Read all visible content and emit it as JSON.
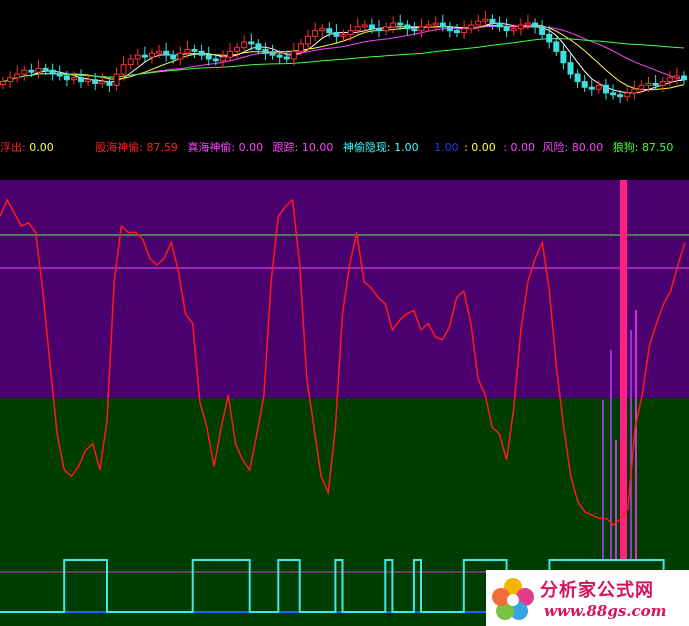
{
  "legend": {
    "fuchu": {
      "label": "浮出:",
      "value": "0.00",
      "color": "#ff2020"
    },
    "guhai": {
      "label": "股海神偷:",
      "value": "87.59",
      "color": "#ff2020"
    },
    "zhenhai": {
      "label": "真海神偷:",
      "value": "0.00",
      "color": "#ff40ff"
    },
    "genzong": {
      "label": "跟踪:",
      "value": "10.00",
      "color": "#ff40ff"
    },
    "yinxian": {
      "label": "神偷隐现:",
      "value": "1.00",
      "color": "#40ffff"
    },
    "blank1": {
      "value": "1.00",
      "color": "#3030ff"
    },
    "blank2": {
      "value": ": 0.00",
      "color": "#ffff40"
    },
    "blank3": {
      "value": ": 0.00",
      "color": "#ff40ff"
    },
    "fengxian": {
      "label": "风险:",
      "value": "80.00",
      "color": "#ff40ff"
    },
    "langou": {
      "label": "狼狗:",
      "value": "87.50",
      "color": "#40ff40"
    }
  },
  "watermark": {
    "title": "分析家公式网",
    "url": "www.88gs.com"
  },
  "colors": {
    "background": "#000000",
    "upper_zone": "#4b0070",
    "lower_zone": "#003d00",
    "main_line": "#ff1a1a",
    "signal_line": "#40e8e8",
    "ref_line_green": "#40ff40",
    "ref_line_magenta": "#ff40ff",
    "spike": "#ff2080",
    "watermark_text": "#d8125b"
  },
  "indicator": {
    "main_line": [
      95,
      100,
      96,
      92,
      93,
      90,
      72,
      50,
      28,
      17,
      15,
      18,
      23,
      25,
      17,
      32,
      75,
      92,
      90,
      90,
      88,
      82,
      80,
      82,
      87,
      78,
      65,
      62,
      38,
      30,
      18,
      30,
      40,
      25,
      20,
      17,
      28,
      40,
      75,
      95,
      98,
      100,
      80,
      45,
      30,
      15,
      10,
      30,
      65,
      80,
      90,
      75,
      73,
      70,
      68,
      60,
      63,
      65,
      66,
      60,
      62,
      58,
      57,
      61,
      70,
      72,
      62,
      45,
      40,
      30,
      28,
      20,
      36,
      60,
      75,
      82,
      87,
      72,
      48,
      30,
      15,
      7,
      4,
      3,
      2,
      2,
      0,
      2,
      5,
      30,
      40,
      55,
      62,
      68,
      72,
      80,
      87
    ],
    "signal_steps": [
      0,
      0,
      0,
      0,
      0,
      0,
      0,
      0,
      0,
      1,
      1,
      1,
      1,
      1,
      1,
      0,
      0,
      0,
      0,
      0,
      0,
      0,
      0,
      0,
      0,
      0,
      0,
      1,
      1,
      1,
      1,
      1,
      1,
      1,
      1,
      0,
      0,
      0,
      0,
      1,
      1,
      1,
      0,
      0,
      0,
      0,
      0,
      1,
      0,
      0,
      0,
      0,
      0,
      0,
      1,
      0,
      0,
      0,
      1,
      0,
      0,
      0,
      0,
      0,
      0,
      1,
      1,
      1,
      1,
      1,
      1,
      0,
      0,
      0,
      0,
      0,
      0,
      1,
      1,
      1,
      1,
      1,
      1,
      1,
      1,
      1,
      1,
      1,
      1,
      1,
      1,
      1,
      1,
      0,
      0,
      0,
      0
    ],
    "upper_ref": 80,
    "lower_ref": 73
  },
  "price": {
    "closes": [
      12.2,
      12.4,
      12.6,
      12.8,
      12.7,
      12.9,
      12.8,
      12.6,
      12.5,
      12.3,
      12.4,
      12.2,
      12.3,
      12.1,
      12.2,
      12.0,
      12.6,
      13.1,
      13.4,
      13.6,
      13.5,
      13.7,
      13.8,
      13.6,
      13.4,
      13.7,
      13.9,
      13.8,
      13.6,
      13.4,
      13.3,
      13.5,
      13.8,
      14.0,
      14.3,
      14.2,
      13.9,
      13.7,
      13.6,
      13.5,
      13.4,
      13.8,
      14.2,
      14.6,
      14.9,
      15.0,
      14.8,
      14.6,
      14.7,
      14.9,
      15.1,
      15.2,
      15.0,
      14.9,
      15.1,
      15.3,
      15.2,
      15.0,
      14.9,
      15.1,
      15.2,
      15.3,
      15.1,
      14.9,
      14.8,
      15.0,
      15.2,
      15.4,
      15.5,
      15.3,
      15.1,
      14.9,
      15.0,
      15.2,
      15.3,
      15.1,
      14.7,
      14.3,
      13.8,
      13.2,
      12.6,
      12.2,
      11.9,
      11.8,
      12.0,
      11.6,
      11.5,
      11.4,
      11.6,
      11.8,
      12.0,
      12.1,
      12.0,
      12.2,
      12.4,
      12.5,
      12.3
    ]
  }
}
